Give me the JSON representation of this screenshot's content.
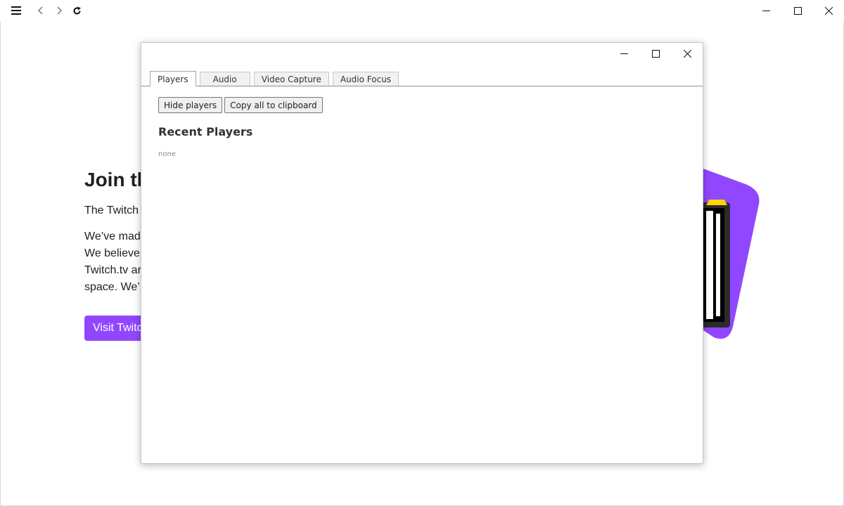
{
  "browser": {
    "icons": {
      "menu": "hamburger-icon",
      "back": "chevron-left-icon",
      "forward": "chevron-right-icon",
      "reload": "reload-icon",
      "minimize": "minimize-icon",
      "maximize": "maximize-icon",
      "close": "close-icon"
    }
  },
  "page": {
    "heading": "Join th",
    "lead": "The Twitch",
    "body_lines": [
      "We’ve mad",
      "We believe",
      "Twitch.tv ar",
      "space. We’"
    ],
    "visit_button": "Visit Twitch",
    "colors": {
      "accent": "#9147ff",
      "text": "#1f1f23"
    }
  },
  "dialog": {
    "tabs": [
      {
        "label": "Players",
        "active": true
      },
      {
        "label": "Audio",
        "active": false
      },
      {
        "label": "Video Capture",
        "active": false
      },
      {
        "label": "Audio Focus",
        "active": false
      }
    ],
    "buttons": {
      "hide_players": "Hide players",
      "copy_all": "Copy all to clipboard"
    },
    "section_title": "Recent Players",
    "empty_text": "none"
  }
}
